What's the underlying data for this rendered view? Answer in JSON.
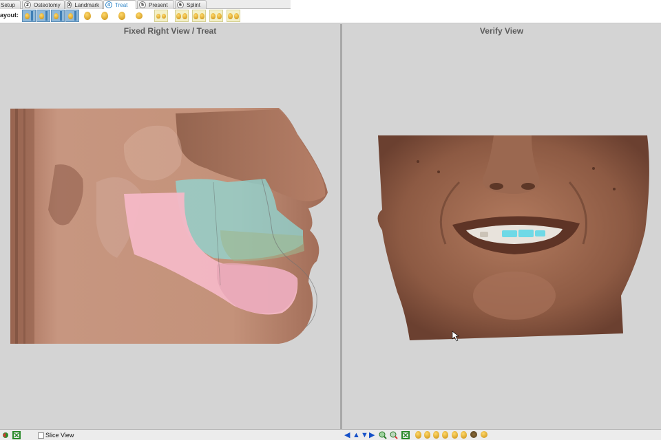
{
  "tabs": [
    {
      "num": "",
      "label": "Setup",
      "active": false
    },
    {
      "num": "2",
      "label": "Osteotomy",
      "active": false
    },
    {
      "num": "3",
      "label": "Landmark",
      "active": false
    },
    {
      "num": "4",
      "label": "Treat",
      "active": true
    },
    {
      "num": "5",
      "label": "Present",
      "active": false
    },
    {
      "num": "6",
      "label": "Splint",
      "active": false
    }
  ],
  "layout": {
    "label": "ayout:",
    "buttons": [
      "layout-1",
      "layout-2",
      "layout-3",
      "layout-4",
      "layout-5",
      "layout-6",
      "layout-7",
      "layout-8",
      "layout-9",
      "layout-10",
      "layout-11",
      "layout-12"
    ]
  },
  "left_view": {
    "title": "Fixed Right View / Treat"
  },
  "right_view": {
    "title": "Verify View"
  },
  "bottom": {
    "slice_view_label": "Slice View",
    "slice_view_checked": false
  },
  "colors": {
    "skin": "#c48a70",
    "mandible": "#f4b6c4",
    "teeth": "#8fe0e0",
    "accent": "#2f86c8",
    "background": "#d4d4d4"
  }
}
